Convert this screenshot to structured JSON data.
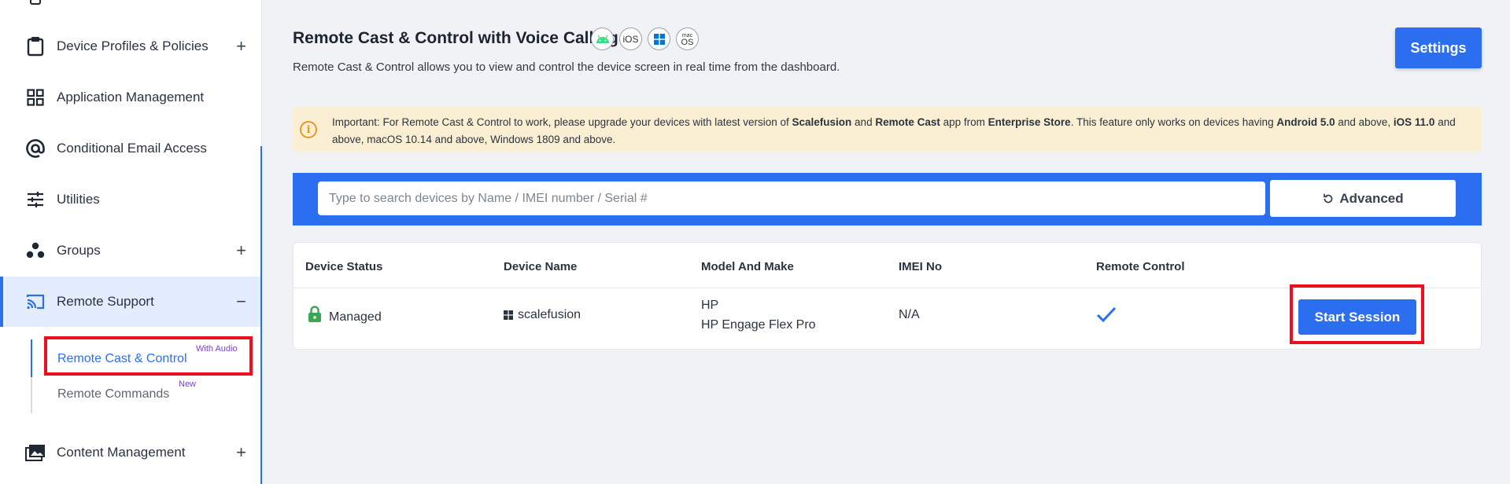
{
  "sidebar": {
    "items": [
      {
        "label": "Device Profiles & Policies",
        "icon": "clipboard-icon",
        "toggle": "+"
      },
      {
        "label": "Application Management",
        "icon": "grid-icon",
        "toggle": ""
      },
      {
        "label": "Conditional Email Access",
        "icon": "at-sign-icon",
        "toggle": ""
      },
      {
        "label": "Utilities",
        "icon": "sliders-icon",
        "toggle": ""
      },
      {
        "label": "Groups",
        "icon": "groups-icon",
        "toggle": "+"
      },
      {
        "label": "Remote Support",
        "icon": "cast-icon",
        "toggle": "−"
      },
      {
        "label": "Content Management",
        "icon": "images-icon",
        "toggle": "+"
      }
    ],
    "sub_items": [
      {
        "label": "Remote Cast & Control",
        "badge": "With Audio"
      },
      {
        "label": "Remote Commands",
        "badge": "New"
      }
    ]
  },
  "page": {
    "title": "Remote Cast & Control with Voice Calling",
    "os_icons": [
      "android-icon",
      "ios-icon",
      "windows-icon",
      "macos-icon"
    ],
    "os_ios_label": "iOS",
    "os_mac_top": "mac",
    "os_mac_bottom": "OS",
    "description": "Remote Cast & Control allows you to view and control the device screen in real time from the dashboard.",
    "settings_label": "Settings"
  },
  "notice": {
    "p1": "Important: For Remote Cast & Control to work, please upgrade your devices with latest version of ",
    "b1": "Scalefusion",
    "p2": " and ",
    "b2": "Remote Cast",
    "p3": " app from ",
    "b3": "Enterprise Store",
    "p4": ". This feature only works on devices having ",
    "b4": "Android 5.0",
    "p5": " and above, ",
    "b5": "iOS 11.0",
    "p6": " and above, macOS 10.14 and above, Windows 1809 and above."
  },
  "search": {
    "placeholder": "Type to search devices by Name / IMEI number / Serial #",
    "advanced_label": "Advanced"
  },
  "table": {
    "headers": [
      "Device Status",
      "Device Name",
      "Model And Make",
      "IMEI No",
      "Remote Control"
    ],
    "rows": [
      {
        "status": "Managed",
        "name": "scalefusion",
        "model_line1": "HP",
        "model_line2": "HP Engage Flex Pro",
        "imei": "N/A",
        "remote_control": "checkmark-icon",
        "action": "Start Session"
      }
    ]
  },
  "colors": {
    "accent": "#2b6ff0",
    "highlight": "#ee0f1e",
    "notice_bg": "#fbefd3",
    "badge": "#7b3fe4",
    "managed_lock": "#3aa757"
  }
}
